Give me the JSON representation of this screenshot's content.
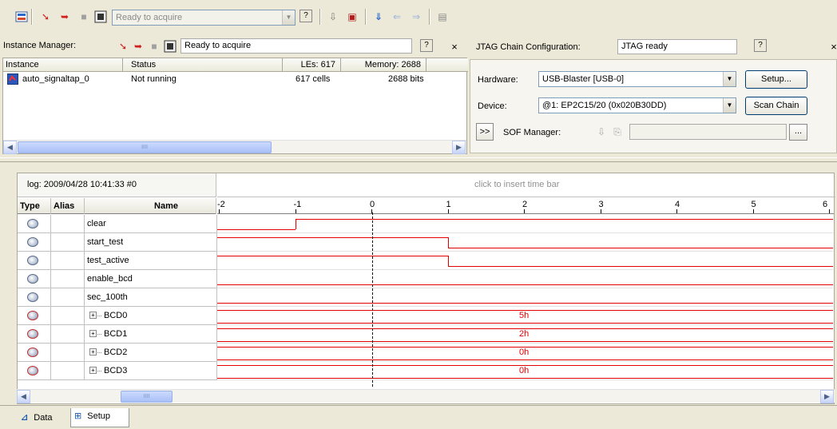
{
  "toolbar": {
    "status_text": "Ready to acquire"
  },
  "instance_manager": {
    "label": "Instance Manager:",
    "status_text": "Ready to acquire",
    "columns": {
      "instance": "Instance",
      "status": "Status",
      "les": "LEs: 617",
      "memory": "Memory: 2688"
    },
    "rows": [
      {
        "instance": "auto_signaltap_0",
        "status": "Not running",
        "les": "617 cells",
        "memory": "2688 bits"
      }
    ],
    "scroll_thumb": "IIII"
  },
  "jtag": {
    "label": "JTAG Chain Configuration:",
    "status_text": "JTAG ready",
    "hardware_label": "Hardware:",
    "hardware_value": "USB-Blaster [USB-0]",
    "setup_button": "Setup...",
    "device_label": "Device:",
    "device_value": "@1: EP2C15/20 (0x020B30DD)",
    "scan_chain_button": "Scan Chain",
    "expand_button": ">>",
    "sof_label": "SOF Manager:",
    "browse_button": "..."
  },
  "waveform": {
    "log_title": "log: 2009/04/28 10:41:33  #0",
    "time_bar_hint": "click to insert time bar",
    "columns": {
      "type": "Type",
      "alias": "Alias",
      "name": "Name"
    },
    "ticks": [
      "-2",
      "-1",
      "0",
      "1",
      "2",
      "3",
      "4",
      "5",
      "6"
    ],
    "signals": [
      {
        "name": "clear",
        "kind": "bit"
      },
      {
        "name": "start_test",
        "kind": "bit"
      },
      {
        "name": "test_active",
        "kind": "bit"
      },
      {
        "name": "enable_bcd",
        "kind": "bit"
      },
      {
        "name": "sec_100th",
        "kind": "bit"
      },
      {
        "name": "BCD0",
        "kind": "bus",
        "value": "5h"
      },
      {
        "name": "BCD1",
        "kind": "bus",
        "value": "2h"
      },
      {
        "name": "BCD2",
        "kind": "bus",
        "value": "0h"
      },
      {
        "name": "BCD3",
        "kind": "bus",
        "value": "0h"
      }
    ],
    "scroll_thumb": "IIII"
  },
  "tabs": [
    {
      "label": "Data"
    },
    {
      "label": "Setup"
    }
  ],
  "colors": {
    "signal": "#e00000",
    "panel_bg": "#ece9d8"
  }
}
